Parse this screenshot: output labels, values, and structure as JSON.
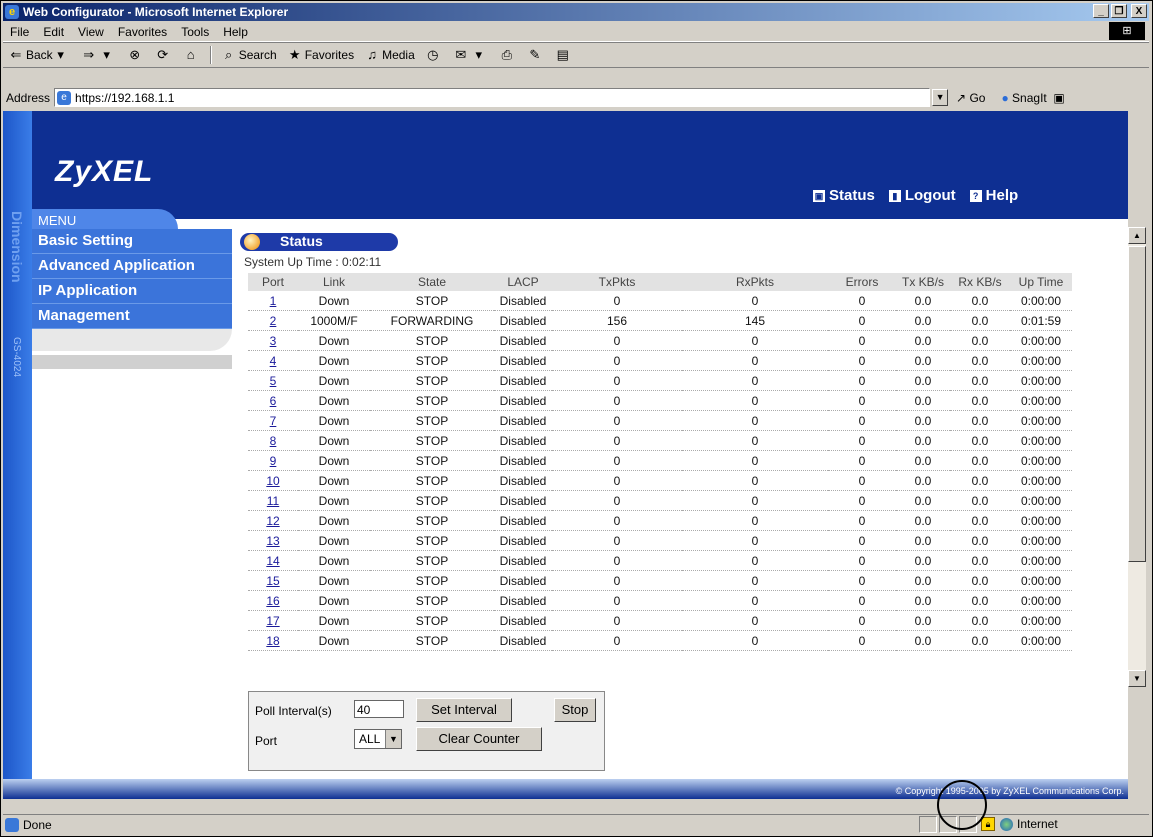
{
  "window": {
    "title": "Web Configurator - Microsoft Internet Explorer",
    "minimize": "_",
    "maximize": "̅",
    "close": "X"
  },
  "menubar": [
    "File",
    "Edit",
    "View",
    "Favorites",
    "Tools",
    "Help"
  ],
  "toolbar": {
    "back": "Back",
    "search": "Search",
    "favorites": "Favorites",
    "media": "Media"
  },
  "address": {
    "label": "Address",
    "url": "https://192.168.1.1",
    "go": "Go",
    "snagit": "SnagIt"
  },
  "brand": {
    "logo": "ZyXEL",
    "side_text": "Dimension",
    "model": "GS-4024"
  },
  "topnav": {
    "status": "Status",
    "logout": "Logout",
    "help": "Help"
  },
  "menu": {
    "header": "MENU",
    "items": [
      "Basic Setting",
      "Advanced Application",
      "IP Application",
      "Management"
    ]
  },
  "content": {
    "title": "Status",
    "uptime": "System Up Time : 0:02:11",
    "columns": [
      "Port",
      "Link",
      "State",
      "LACP",
      "TxPkts",
      "RxPkts",
      "Errors",
      "Tx KB/s",
      "Rx KB/s",
      "Up Time"
    ],
    "rows": [
      [
        "1",
        "Down",
        "STOP",
        "Disabled",
        "0",
        "0",
        "0",
        "0.0",
        "0.0",
        "0:00:00"
      ],
      [
        "2",
        "1000M/F",
        "FORWARDING",
        "Disabled",
        "156",
        "145",
        "0",
        "0.0",
        "0.0",
        "0:01:59"
      ],
      [
        "3",
        "Down",
        "STOP",
        "Disabled",
        "0",
        "0",
        "0",
        "0.0",
        "0.0",
        "0:00:00"
      ],
      [
        "4",
        "Down",
        "STOP",
        "Disabled",
        "0",
        "0",
        "0",
        "0.0",
        "0.0",
        "0:00:00"
      ],
      [
        "5",
        "Down",
        "STOP",
        "Disabled",
        "0",
        "0",
        "0",
        "0.0",
        "0.0",
        "0:00:00"
      ],
      [
        "6",
        "Down",
        "STOP",
        "Disabled",
        "0",
        "0",
        "0",
        "0.0",
        "0.0",
        "0:00:00"
      ],
      [
        "7",
        "Down",
        "STOP",
        "Disabled",
        "0",
        "0",
        "0",
        "0.0",
        "0.0",
        "0:00:00"
      ],
      [
        "8",
        "Down",
        "STOP",
        "Disabled",
        "0",
        "0",
        "0",
        "0.0",
        "0.0",
        "0:00:00"
      ],
      [
        "9",
        "Down",
        "STOP",
        "Disabled",
        "0",
        "0",
        "0",
        "0.0",
        "0.0",
        "0:00:00"
      ],
      [
        "10",
        "Down",
        "STOP",
        "Disabled",
        "0",
        "0",
        "0",
        "0.0",
        "0.0",
        "0:00:00"
      ],
      [
        "11",
        "Down",
        "STOP",
        "Disabled",
        "0",
        "0",
        "0",
        "0.0",
        "0.0",
        "0:00:00"
      ],
      [
        "12",
        "Down",
        "STOP",
        "Disabled",
        "0",
        "0",
        "0",
        "0.0",
        "0.0",
        "0:00:00"
      ],
      [
        "13",
        "Down",
        "STOP",
        "Disabled",
        "0",
        "0",
        "0",
        "0.0",
        "0.0",
        "0:00:00"
      ],
      [
        "14",
        "Down",
        "STOP",
        "Disabled",
        "0",
        "0",
        "0",
        "0.0",
        "0.0",
        "0:00:00"
      ],
      [
        "15",
        "Down",
        "STOP",
        "Disabled",
        "0",
        "0",
        "0",
        "0.0",
        "0.0",
        "0:00:00"
      ],
      [
        "16",
        "Down",
        "STOP",
        "Disabled",
        "0",
        "0",
        "0",
        "0.0",
        "0.0",
        "0:00:00"
      ],
      [
        "17",
        "Down",
        "STOP",
        "Disabled",
        "0",
        "0",
        "0",
        "0.0",
        "0.0",
        "0:00:00"
      ],
      [
        "18",
        "Down",
        "STOP",
        "Disabled",
        "0",
        "0",
        "0",
        "0.0",
        "0.0",
        "0:00:00"
      ]
    ]
  },
  "controls": {
    "poll_label": "Poll Interval(s)",
    "poll_value": "40",
    "set_interval": "Set Interval",
    "stop": "Stop",
    "port_label": "Port",
    "port_value": "ALL",
    "clear_counter": "Clear Counter"
  },
  "footer": {
    "copyright": "© Copyright 1995-2005 by ZyXEL Communications Corp."
  },
  "statusbar": {
    "text": "Done",
    "zone": "Internet"
  },
  "colors": {
    "header": "#0e2f92",
    "menu": "#3b74da",
    "pill": "#1e3aa8"
  }
}
